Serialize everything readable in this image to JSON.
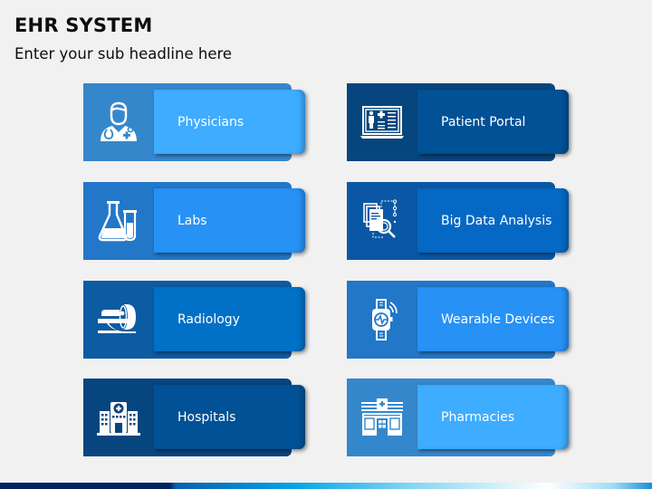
{
  "header": {
    "title": "EHR SYSTEM",
    "subtitle": "Enter your sub headline here"
  },
  "cards": [
    {
      "label": "Physicians",
      "icon": "doctor-icon",
      "back_color": "#3587cc",
      "front_color": "#3eacff"
    },
    {
      "label": "Patient Portal",
      "icon": "patient-portal-icon",
      "back_color": "#07457e",
      "front_color": "#005195"
    },
    {
      "label": "Labs",
      "icon": "lab-flask-icon",
      "back_color": "#2277c8",
      "front_color": "#2791f5"
    },
    {
      "label": "Big Data Analysis",
      "icon": "data-analysis-icon",
      "back_color": "#0a58a5",
      "front_color": "#0468c4"
    },
    {
      "label": "Radiology",
      "icon": "mri-scanner-icon",
      "back_color": "#0d5ba3",
      "front_color": "#0071c6"
    },
    {
      "label": "Wearable Devices",
      "icon": "smartwatch-icon",
      "back_color": "#2277c8",
      "front_color": "#2791f5"
    },
    {
      "label": "Hospitals",
      "icon": "hospital-icon",
      "back_color": "#07457e",
      "front_color": "#005195"
    },
    {
      "label": "Pharmacies",
      "icon": "pharmacy-icon",
      "back_color": "#3587cc",
      "front_color": "#3eacff"
    }
  ]
}
